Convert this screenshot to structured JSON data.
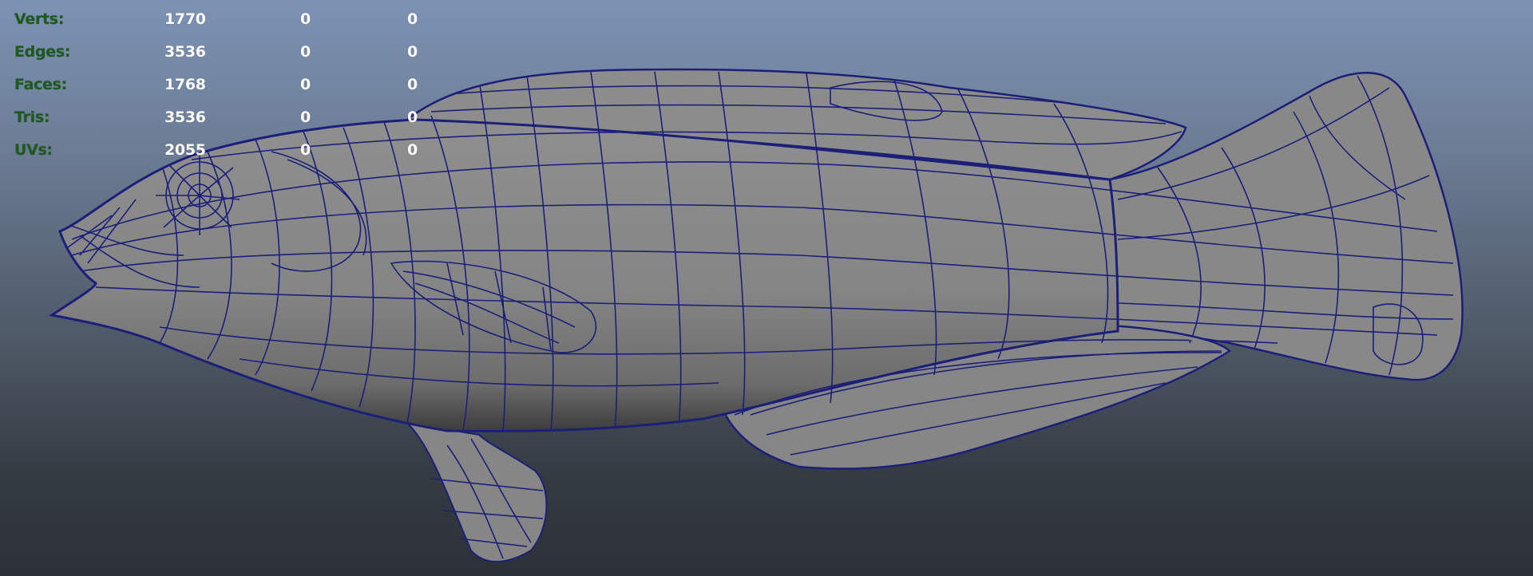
{
  "viewport": {
    "model": "fish-polygon-mesh"
  },
  "hud": {
    "rows": [
      {
        "label": "Verts:",
        "total": "1770",
        "selected": "0",
        "selected2": "0"
      },
      {
        "label": "Edges:",
        "total": "3536",
        "selected": "0",
        "selected2": "0"
      },
      {
        "label": "Faces:",
        "total": "1768",
        "selected": "0",
        "selected2": "0"
      },
      {
        "label": "Tris:",
        "total": "3536",
        "selected": "0",
        "selected2": "0"
      },
      {
        "label": "UVs:",
        "total": "2055",
        "selected": "0",
        "selected2": "0"
      }
    ]
  },
  "colors": {
    "label_green": "#1e5a1e",
    "value_white": "#ffffff",
    "wire_blue": "#1c1f78",
    "mesh_gray": "#858585"
  }
}
